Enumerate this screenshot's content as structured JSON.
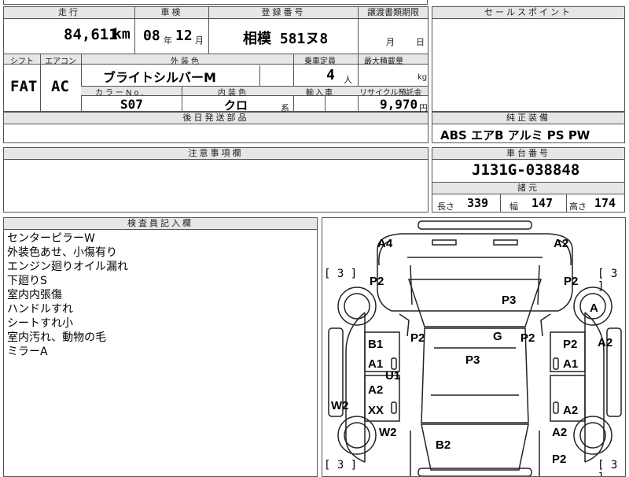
{
  "top_partial": {
    "a": "",
    "b": ""
  },
  "headers": {
    "mileage": "走行",
    "inspection": "車検",
    "reg_no": "登録番号",
    "transfer_deadline": "譲渡書類期限",
    "sales_point": "セールスポイント",
    "shift": "シフト",
    "aircon": "エアコン",
    "exterior_color": "外装色",
    "capacity": "乗車定員",
    "max_load": "最大積載量",
    "color_no": "カラーNo.",
    "interior_color": "内装色",
    "import": "輸入車",
    "recycle": "リサイクル預託金",
    "later_parts": "後日発送部品",
    "standard_equipment": "純正装備",
    "notes": "注意事項欄",
    "chassis_no": "車台番号",
    "dimensions": "諸元",
    "inspector_notes": "検査員記入欄"
  },
  "values": {
    "mileage": "84,611",
    "mileage_unit": "km",
    "inspection_year": "08",
    "year_unit": "年",
    "inspection_month": "12",
    "month_unit": "月",
    "reg_no": "相模 581ヌ8",
    "deadline_month": "月",
    "deadline_day": "日",
    "shift": "FAT",
    "aircon": "AC",
    "exterior_color": "ブライトシルバーM",
    "capacity": "4",
    "capacity_unit": "人",
    "load_unit": "kg",
    "color_no": "S07",
    "interior_color": "クロ",
    "interior_suffix": "系",
    "recycle": "9,970",
    "recycle_unit": "円",
    "equipment": "ABS エアB アルミ PS PW",
    "chassis_no": "J131G-038848",
    "length_label": "長さ",
    "length": "339",
    "width_label": "幅",
    "width": "147",
    "height_label": "高さ",
    "height": "174"
  },
  "remarks": [
    "センターピラーW",
    "外装色あせ、小傷有り",
    "エンジン廻りオイル漏れ",
    "下廻りS",
    "室内内張傷",
    "ハンドルすれ",
    "シートすれ小",
    "室内汚れ、動物の毛",
    "ミラーA"
  ],
  "diagram": {
    "marks": {
      "a4": "A4",
      "a2_top": "A2",
      "p2_fl": "P2",
      "p2_fr": "P2",
      "p3_hood": "P3",
      "a_tire": "A",
      "b1": "B1",
      "p2_left_pillar": "P2",
      "g": "G",
      "p2_right_pillar": "P2",
      "p2_right_door": "P2",
      "a2_right_edge": "A2",
      "a1_left": "A1",
      "u1": "U1",
      "p3_roof": "P3",
      "a1_right": "A1",
      "a2_left_rear": "A2",
      "w2_left": "W2",
      "xx": "XX",
      "a2_right_rear": "A2",
      "w2_rear": "W2",
      "a2_rr": "A2",
      "b2": "B2",
      "p2_bottom": "P2"
    },
    "bracket_values": [
      "3",
      "3",
      "3",
      "3"
    ]
  }
}
